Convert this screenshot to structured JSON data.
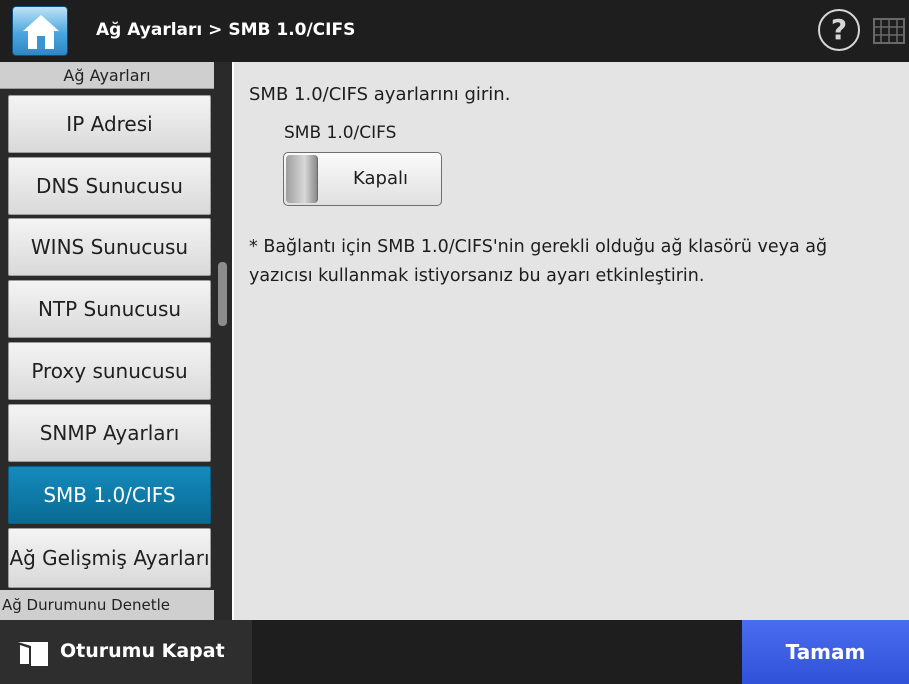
{
  "header": {
    "breadcrumb": "Ağ Ayarları > SMB 1.0/CIFS",
    "help_label": "?",
    "home_icon": "home-icon",
    "keyboard_icon": "keyboard-icon"
  },
  "sidebar": {
    "header": "Ağ Ayarları",
    "items": [
      {
        "label": "IP Adresi"
      },
      {
        "label": "DNS Sunucusu"
      },
      {
        "label": "WINS Sunucusu"
      },
      {
        "label": "NTP Sunucusu"
      },
      {
        "label": "Proxy sunucusu"
      },
      {
        "label": "SNMP Ayarları"
      },
      {
        "label": "SMB 1.0/CIFS"
      },
      {
        "label": "Ağ Gelişmiş Ayarları"
      }
    ],
    "selected": "SMB 1.0/CIFS",
    "footer": "Ağ Durumunu Denetle"
  },
  "main": {
    "instruction": "SMB 1.0/CIFS ayarlarını girin.",
    "toggle_label": "SMB 1.0/CIFS",
    "toggle_value": "Kapalı",
    "note": "* Bağlantı için SMB 1.0/CIFS'nin gerekli olduğu ağ klasörü veya ağ yazıcısı kullanmak istiyorsanız bu ayarı etkinleştirin."
  },
  "footer": {
    "logout_label": "Oturumu Kapat",
    "ok_label": "Tamam",
    "logout_icon": "logout-icon"
  },
  "colors": {
    "selected": "#0a6a94",
    "ok_button": "#2f52d8",
    "bar": "#1e1e1e"
  }
}
